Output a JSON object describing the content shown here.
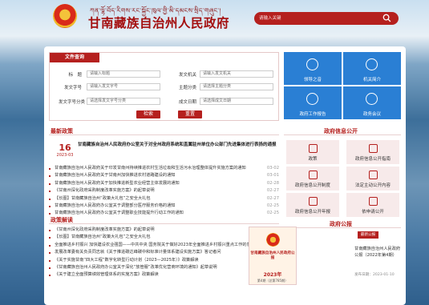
{
  "header": {
    "tibetan_title": "ཀན་ལྷོ་བོད་རིགས་རང་སྐྱོང་ཁུལ་གྱི་མི་དམངས་སྲིད་གཞུང་།",
    "title": "甘南藏族自治州人民政府",
    "search_placeholder": "请输入关键"
  },
  "file_search": {
    "tab": "文件查询",
    "fields": [
      {
        "label": "标　题",
        "placeholder": "请输入标题"
      },
      {
        "label": "发文机关",
        "placeholder": "请输入发文机关"
      },
      {
        "label": "发文字号",
        "placeholder": "请输入发文字号"
      },
      {
        "label": "主题分类",
        "placeholder": "请选择主题分类"
      },
      {
        "label": "发文字号分类",
        "placeholder": "请选择发文字号分类"
      },
      {
        "label": "成文日期",
        "placeholder": "请选择成文日期"
      }
    ],
    "search_button": "检索",
    "reset_button": "重置"
  },
  "tiles": [
    {
      "label": "领导之音",
      "icon": "leader-icon"
    },
    {
      "label": "机关简介",
      "icon": "building-icon"
    },
    {
      "label": "政府工作报告",
      "icon": "report-icon"
    },
    {
      "label": "政务会议",
      "icon": "meeting-icon"
    }
  ],
  "news": {
    "title": "最新政策",
    "featured": {
      "day": "16",
      "ym": "2023-03",
      "title": "甘南藏族自治州人民政府办公室关于对全州政府系统和直属驻州单位办公部门先进集体进行表扬的通报"
    },
    "items": [
      {
        "text": "甘南藏族自治州人民政府关于印发甘南州持续推进农村生活垃圾和生活污水治理整体提升实施方案的通知",
        "date": "03-02"
      },
      {
        "text": "甘南藏族自治州人民政府关于甘南州加快推进农村道路建设的通知",
        "date": "03-01"
      },
      {
        "text": "甘南藏族自治州人民政府关于加快推进新型农业经营主体发展的通知",
        "date": "02-28"
      },
      {
        "text": "《甘南州深化政府采购制度改革实施方案》的起草说明",
        "date": "02-27"
      },
      {
        "text": "【长图】甘南藏族自治州“政策大礼包”之安全大礼包",
        "date": "02-27"
      },
      {
        "text": "甘南藏族自治州人民政府办公室关于调整部分医疗服务价格的通知",
        "date": "02-25"
      },
      {
        "text": "甘南藏族自治州人民政府办公室关于调整职业技能提升行动工作的通知",
        "date": "02-25"
      }
    ]
  },
  "policy": {
    "title": "政策解读",
    "items": [
      {
        "text": "《甘南州深化政府采购制度改革实施方案》的起草说明",
        "date": "02-27"
      },
      {
        "text": "【长图】甘南藏族自治州“政策大礼包”之安全大礼包",
        "date": "02-27"
      },
      {
        "text": "全面推进乡村振兴 加快建设农业强国——中共中央 国务院关于做好2023年全面推进乡村振兴重点工作的意见",
        "date": "02-14"
      },
      {
        "text": "发展改革委有关负责同志就《关于推进碳达峰碳中和标准计量体系建设实施方案》答记者问",
        "date": "02-13"
      },
      {
        "text": "《关于实施甘南“四大工程”数字化转型行动计划（2023—2025年）》政策解读",
        "date": "02-10"
      },
      {
        "text": "《甘南藏族自治州人民政府办公室关于深化“放管服”改革优化营商环境的通知》起草说明",
        "date": "02-08"
      },
      {
        "text": "《关于建立全面预算绩效管理体系的实施方案》政策解读",
        "date": "02-06"
      }
    ]
  },
  "services": {
    "title": "政府信息公开",
    "items": [
      {
        "label": "政策",
        "icon": "policy-icon"
      },
      {
        "label": "政府信息公开指南",
        "icon": "guide-icon"
      },
      {
        "label": "政府信息公开制度",
        "icon": "rules-icon"
      },
      {
        "label": "法定主动公开内容",
        "icon": "content-icon"
      },
      {
        "label": "政府信息公开年报",
        "icon": "annual-icon"
      },
      {
        "label": "依申请公开",
        "icon": "apply-icon"
      }
    ]
  },
  "gazette": {
    "title": "政府公报",
    "tag": "最新公报",
    "cover_title": "甘南藏族自治州人民政府公报",
    "cover_year": "2023年",
    "cover_issue": "第4期（总第785期）",
    "name": "甘南藏族自治州人民政府公报（2022年第4期）",
    "date_label": "发布日期：2023-01-10"
  },
  "colors": {
    "primary": "#b5201e",
    "tile": "#2a7fd4",
    "service_bg": "#f7eaea"
  }
}
